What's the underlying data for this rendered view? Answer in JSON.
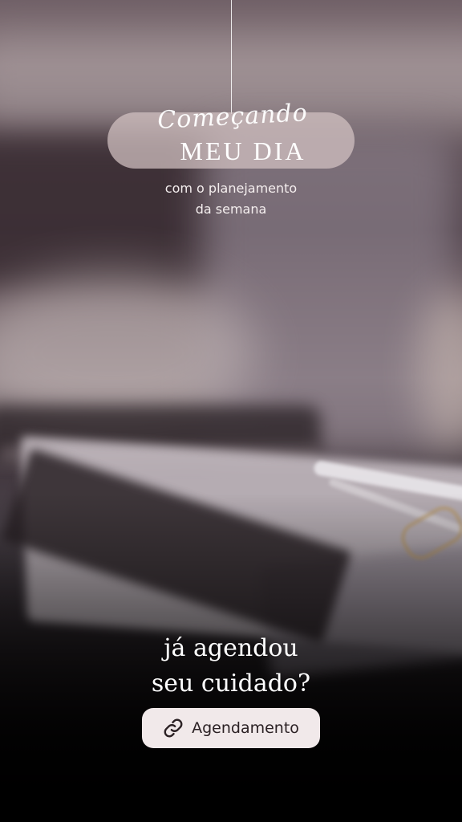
{
  "story": {
    "title_script": "Começando",
    "title_main": "MEU DIA",
    "subtitle_line1": "com o planejamento",
    "subtitle_line2": "da semana",
    "question_line1": "já agendou",
    "question_line2": "seu cuidado?",
    "link_button": {
      "label": "Agendamento",
      "icon": "link-icon"
    }
  },
  "colors": {
    "pill": "#d4c4c4",
    "button_bg": "#f1e9ea",
    "button_text": "#2b2124",
    "text": "#ffffff"
  }
}
